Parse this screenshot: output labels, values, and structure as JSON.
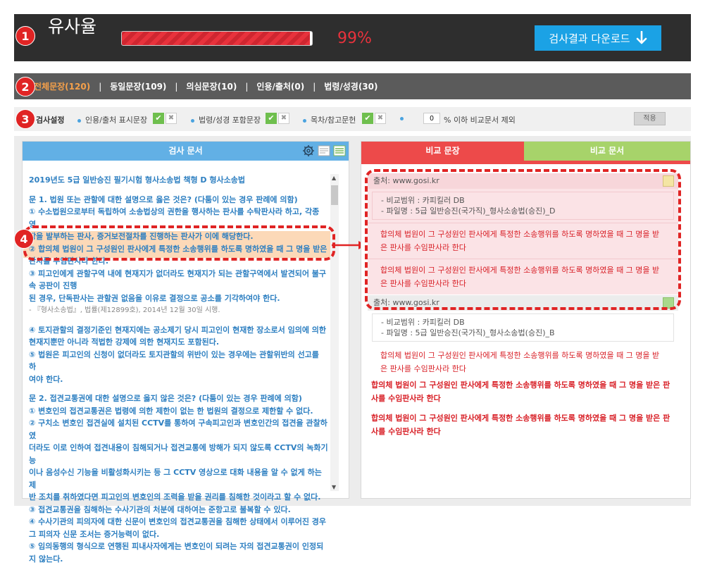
{
  "header": {
    "badge": "1",
    "title": "유사율",
    "progress": 0.99,
    "percent": "99%",
    "download_label": "검사결과 다운로드"
  },
  "tabs": {
    "badge": "2",
    "items": [
      "전체문장(120)",
      "동일문장(109)",
      "의심문장(10)",
      "인용/출처(0)",
      "법령/성경(30)"
    ],
    "separator": "|"
  },
  "settings": {
    "badge": "3",
    "label": "검사설정",
    "options": [
      "인용/출처 표시문장",
      "법령/성경 포함문장",
      "목차/참고문헌"
    ],
    "exclude_value": "0",
    "exclude_label": "% 이하 비교문서 제외",
    "apply_label": "적용"
  },
  "left_panel": {
    "header": "검사 문서",
    "badge": "4",
    "lines": [
      "2019년도 5급 일반승진 필기시험 형사소송법 책형 D 형사소송법",
      "",
      "문 1. 법원 또는 관할에 대한 설명으로 옳은 것은? (다툼이 있는 경우 판례에 의함)",
      "① 수소법원으로부터 독립하여 소송법상의 권한을 행사하는 판사를 수탁판사라 하고, 각종 영",
      "장을 발부하는 판사, 증거보전절차를 진행하는 판사가 이에 해당한다.",
      "② 합의체 법원이 그 구성원인 판사에게 특정한 소송행위를 하도록 명하였을 때 그 명을 받은",
      "판사를 수임판사라 한다.",
      "③ 피고인에게 관할구역 내에 현재지가 없더라도 현재지가 되는 관할구역에서 발견되어 불구속 공판이 진행",
      "된 경우, 단독판사는 관할권 없음을 이유로 결정으로 공소를 기각하여야 한다.",
      "- 『형사소송법』, 법률(제12899호), 2014년 12월 30일 시행.",
      "",
      "④ 토지관할의 결정기준인 현재지에는 공소제기 당시 피고인이 현재한 장소로서 임의에 의한",
      "현재지뿐만 아니라 적법한 강제에 의한 현재지도 포함된다.",
      "⑤ 법원은 피고인의 신청이 없더라도 토지관할의 위반이 있는 경우에는 관할위반의 선고를 하",
      "여야 한다.",
      "",
      "문 2. 접견교통권에 대한 설명으로 옳지 않은 것은? (다툼이 있는 경우 판례에 의함)",
      "① 변호인의 접견교통권은 법령에 의한 제한이 없는 한 법원의 결정으로 제한할 수 없다.",
      "② 구치소 변호인 접견실에 설치된 CCTV를 통하여 구속피고인과 변호인간의 접견을 관찰하였",
      "더라도 이로 인하여 접견내용이 침해되거나 접견교통에 방해가 되지 않도록 CCTV의 녹화기능",
      "이나 음성수신 기능을 비활성화시키는 등 그 CCTV 영상으로 대화 내용을 알 수 없게 하는 제",
      "반 조치를 취하였다면 피고인의 변호인의 조력을 받을 권리를 침해한 것이라고 할 수 없다.",
      "③ 접견교통권을 침해하는 수사기관의 처분에 대하여는 준항고로 불복할 수 있다.",
      "④ 수사기관의 피의자에 대한 신문이 변호인의 접견교통권을 침해한 상태에서 이루어진 경우",
      "그 피의자 신문 조서는 증거능력이 없다.",
      "⑤ 임의동행의 형식으로 연행된 피내사자에게는 변호인이 되려는 자의 접견교통권이 인정되",
      "지 않는다."
    ]
  },
  "right_panel": {
    "tab_compare_sentence": "비교 문장",
    "tab_compare_doc": "비교 문서",
    "sources": [
      {
        "source": "출처: www.gosi.kr",
        "scope": "- 비교범위 : 카피킬러 DB",
        "file": "- 파일명 : 5급 일반승진(국가직)_형사소송법(승진)_D",
        "matches": [
          "합의체 법원이 그 구성원인 판사에게 특정한 소송행위를 하도록 명하였을 때 그 명을 받은 판사를 수임판사라 한다",
          "합의체 법원이 그 구성원인 판사에게 특정한 소송행위를 하도록 명하였을 때 그 명을 받은 판사를 수임판사라 한다"
        ]
      },
      {
        "source": "출처: www.gosi.kr",
        "scope": "- 비교범위 : 카피킬러 DB",
        "file": "- 파일명 : 5급 일반승진(국가직)_형사소송법(승진)_B",
        "matches": [
          "합의체 법원이 그 구성원인 판사에게 특정한 소송행위를 하도록 명하였을 때 그 명을 받은 판사를 수임판사라 한다"
        ]
      }
    ],
    "plain_matches": [
      "합의체 법원이 그 구성원인 판사에게 특정한 소송행위를 하도록 명하였을 때 그 명을 받은 판사를 수임판사라 한다",
      "합의체 법원이 그 구성원인 판사에게 특정한 소송행위를 하도록 명하였을 때 그 명을 받은 판사를 수임판사라 한다"
    ]
  },
  "colors": {
    "accent_blue": "#1ba2e5",
    "accent_red": "#e8323c",
    "tab_active": "#f5a04a",
    "text_blue": "#2d7fc1",
    "match_red": "#d81f26"
  }
}
